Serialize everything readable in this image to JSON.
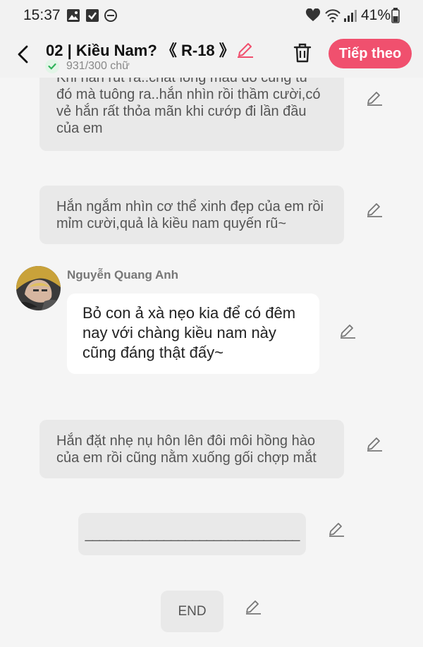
{
  "status_bar": {
    "time": "15:37",
    "battery": "41%",
    "icons": [
      "image-icon",
      "checkbox-icon",
      "do-not-disturb-icon",
      "heart-icon",
      "wifi-icon",
      "signal-icon",
      "battery-icon"
    ]
  },
  "header": {
    "title": "02 | Kiều Nam? 《 R-18 》",
    "word_count": "931/300 chữ",
    "next_label": "Tiếp theo",
    "accent_color": "#f0506e"
  },
  "messages": [
    {
      "type": "narration",
      "lines": [
        "Khi hắn rút ra..chất lỏng màu đỏ cũng từ",
        "đó mà tuông ra..hắn nhìn rồi thầm cười,có",
        "vẻ hắn rất thỏa mãn khi cướp đi lần đầu",
        "của em"
      ]
    },
    {
      "type": "narration",
      "lines": [
        "Hắn ngắm nhìn cơ thể xinh đẹp của em rồi",
        "mỉm cười,quả là kiều nam quyến rũ~"
      ]
    },
    {
      "type": "dialogue",
      "speaker": "Nguyễn Quang Anh",
      "lines": [
        "Bỏ con ả xà nẹo kia để có đêm",
        "nay với chàng kiều nam này",
        "cũng đáng thật đấy~"
      ]
    },
    {
      "type": "narration",
      "lines": [
        "Hắn đặt nhẹ nụ hôn lên đôi môi hồng hào",
        "của em rồi cũng nằm xuống gối chợp mắt"
      ]
    },
    {
      "type": "narration",
      "lines": [
        "______________________________"
      ]
    },
    {
      "type": "narration",
      "lines": [
        "END"
      ]
    }
  ]
}
